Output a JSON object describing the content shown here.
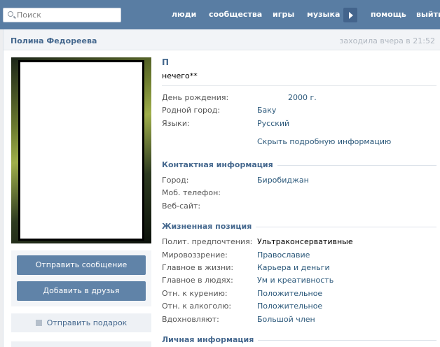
{
  "topbar": {
    "search_placeholder": "Поиск",
    "nav": [
      "люди",
      "сообщества",
      "игры",
      "музыка",
      "помощь",
      "выйти"
    ]
  },
  "profile": {
    "full_name": "Полина Федореева",
    "last_seen": "заходила вчера в 21:52",
    "name_short": "П",
    "status": "нечего**",
    "actions": {
      "message": "Отправить сообщение",
      "add_friend": "Добавить в друзья",
      "gift": "Отправить подарок"
    },
    "basic": {
      "birthday_label": "День рождения:",
      "birthday_value": "2000 г.",
      "hometown_label": "Родной город:",
      "hometown_value": "Баку",
      "languages_label": "Языки:",
      "languages_value": "Русский"
    },
    "hide_details": "Скрыть подробную информацию",
    "contact": {
      "title": "Контактная информация",
      "city_label": "Город:",
      "city_value": "Биробиджан",
      "phone_label": "Моб. телефон:",
      "site_label": "Веб-сайт:"
    },
    "life": {
      "title": "Жизненная позиция",
      "rows": [
        {
          "label": "Полит. предпочтения:",
          "value": "Ультраконсервативные"
        },
        {
          "label": "Мировоззрение:",
          "value": "Православие"
        },
        {
          "label": "Главное в жизни:",
          "value": "Карьера и деньги"
        },
        {
          "label": "Главное в людях:",
          "value": "Ум и креативность"
        },
        {
          "label": "Отн. к курению:",
          "value": "Положительное"
        },
        {
          "label": "Отн. к алкоголю:",
          "value": "Положительное"
        },
        {
          "label": "Вдохновляют:",
          "value": "Большой член"
        }
      ]
    },
    "personal": {
      "title": "Личная информация"
    }
  }
}
